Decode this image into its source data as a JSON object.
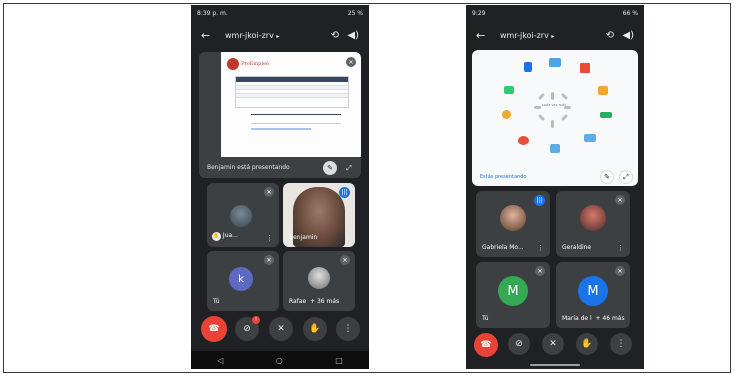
{
  "phone_left": {
    "status": {
      "time": "8:39 p. m.",
      "battery": "25 %"
    },
    "meeting_code": "wmr-jkoi-zrv",
    "presentation": {
      "brand": "ProEmpleo",
      "caption": "Benjamin está presentando"
    },
    "tiles": [
      {
        "name": "Jua...",
        "kind": "photo"
      },
      {
        "name": "Benjamin",
        "kind": "video"
      },
      {
        "name": "Tú",
        "kind": "initial",
        "initial": "k",
        "color": "#5c6bc0"
      },
      {
        "name": "Rafae",
        "extra": "+ 36 más",
        "kind": "photo"
      }
    ],
    "nav": {
      "back": "◁",
      "home": "○",
      "recent": "□"
    }
  },
  "phone_right": {
    "status": {
      "time": "9:29",
      "battery": "66 %"
    },
    "meeting_code": "wmr-jkoi-zrv",
    "presentation": {
      "center_text": "cada vez más",
      "caption": "Estás presentando"
    },
    "tiles": [
      {
        "name": "Gabriela Mo...",
        "kind": "photo"
      },
      {
        "name": "Geraldine",
        "kind": "photo"
      },
      {
        "name": "Tú",
        "kind": "initial",
        "initial": "M",
        "color": "#34a853"
      },
      {
        "name": "Maria de l",
        "extra": "+ 46 más",
        "kind": "initial",
        "initial": "M",
        "color": "#1a73e8"
      }
    ]
  },
  "icons": {
    "back": "←",
    "camera_switch": "⟲",
    "speaker": "◀)",
    "end_call": "☎",
    "camera_off": "⊘",
    "mic_off": "✕",
    "hand": "✋",
    "more": "⋮",
    "mute": "✕",
    "speaking": "|||"
  },
  "colors": {
    "end_call": "#ea4335",
    "speaking": "#1a73e8",
    "tile": "#3c4043",
    "background": "#202124"
  }
}
